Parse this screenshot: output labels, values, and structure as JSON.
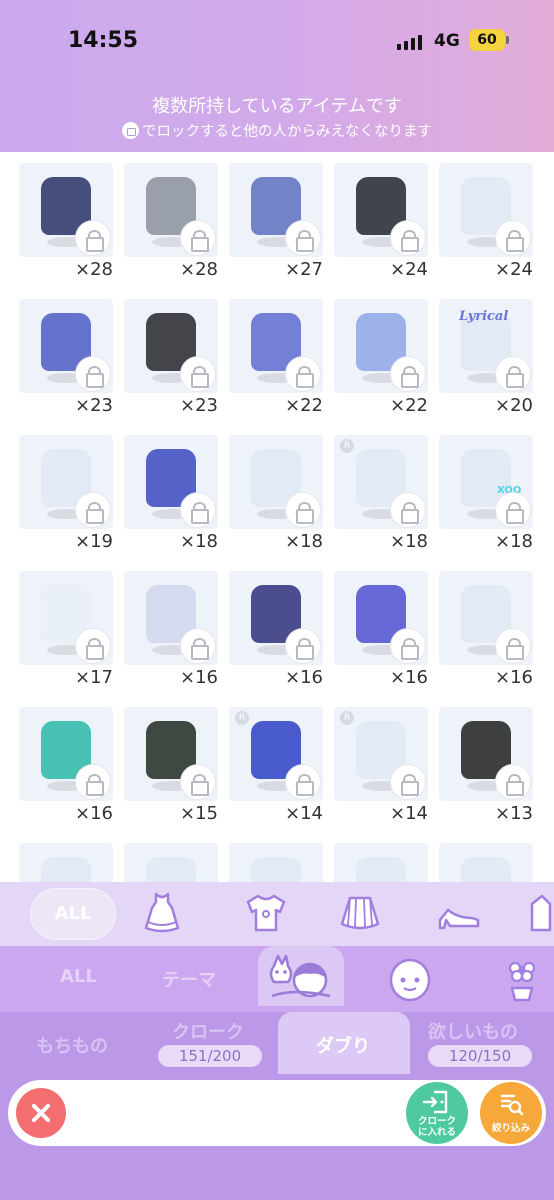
{
  "status": {
    "time": "14:55",
    "network": "4G",
    "battery": "60"
  },
  "header": {
    "title": "複数所持しているアイテムです",
    "subtitle": "でロックすると他の人からみえなくなります"
  },
  "items": [
    {
      "qty": "×28"
    },
    {
      "qty": "×28"
    },
    {
      "qty": "×27"
    },
    {
      "qty": "×24"
    },
    {
      "qty": "×24"
    },
    {
      "qty": "×23"
    },
    {
      "qty": "×23"
    },
    {
      "qty": "×22"
    },
    {
      "qty": "×22"
    },
    {
      "qty": "×20"
    },
    {
      "qty": "×19"
    },
    {
      "qty": "×18"
    },
    {
      "qty": "×18"
    },
    {
      "qty": "×18"
    },
    {
      "qty": "×18"
    },
    {
      "qty": "×17"
    },
    {
      "qty": "×16"
    },
    {
      "qty": "×16"
    },
    {
      "qty": "×16"
    },
    {
      "qty": "×16"
    },
    {
      "qty": "×16"
    },
    {
      "qty": "×15"
    },
    {
      "qty": "×14"
    },
    {
      "qty": "×14"
    },
    {
      "qty": "×13"
    }
  ],
  "item_text": {
    "lyrical_label": "Lyrical",
    "xoo_label": "XOO",
    "rare_mark": "R"
  },
  "category_row": {
    "all_label": "ALL"
  },
  "sub_row": {
    "all_label": "ALL",
    "theme_label": "テーマ"
  },
  "main_tabs": {
    "owned_label": "もちもの",
    "closet_label": "クローク",
    "closet_count": "151/200",
    "duplicates_label": "ダブり",
    "wishlist_label": "欲しいもの",
    "wishlist_count": "120/150"
  },
  "actions": {
    "to_closet_label": "クロークに入れる",
    "filter_label": "絞り込み"
  },
  "colors": {
    "header_gradient_start": "#c9a9ec",
    "header_gradient_end": "#e2acd9",
    "tab_purple": "#bc99e8",
    "close_red": "#f26e6f",
    "closet_green": "#4ec9a0",
    "filter_orange": "#f6a83a"
  }
}
